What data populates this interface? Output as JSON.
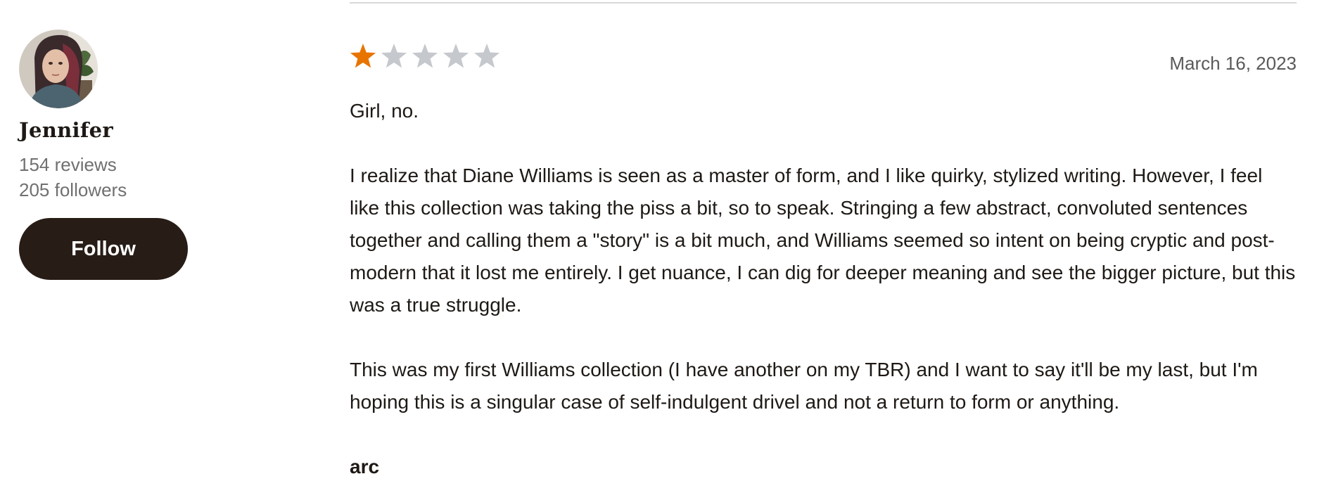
{
  "reviewer": {
    "name": "Jennifer",
    "reviews": "154 reviews",
    "followers": "205 followers",
    "follow_label": "Follow",
    "avatar_icon": "user-avatar-photo"
  },
  "review": {
    "rating": 1,
    "max_rating": 5,
    "star_filled_color": "#e87400",
    "star_empty_color": "#c5c8cc",
    "date": "March 16, 2023",
    "paragraphs": [
      "Girl, no.",
      "I realize that Diane Williams is seen as a master of form, and I like quirky, stylized writing. However, I feel like this collection was taking the piss a bit, so to speak. Stringing a few abstract, convoluted sentences together and calling them a \"story\" is a bit much, and Williams seemed so intent on being cryptic and post-modern that it lost me entirely. I get nuance, I can dig for deeper meaning and see the bigger picture, but this was a true struggle.",
      "This was my first Williams collection (I have another on my TBR) and I want to say it'll be my last, but I'm hoping this is a singular case of self-indulgent drivel and not a return to form or anything."
    ],
    "shelf": "arc"
  }
}
